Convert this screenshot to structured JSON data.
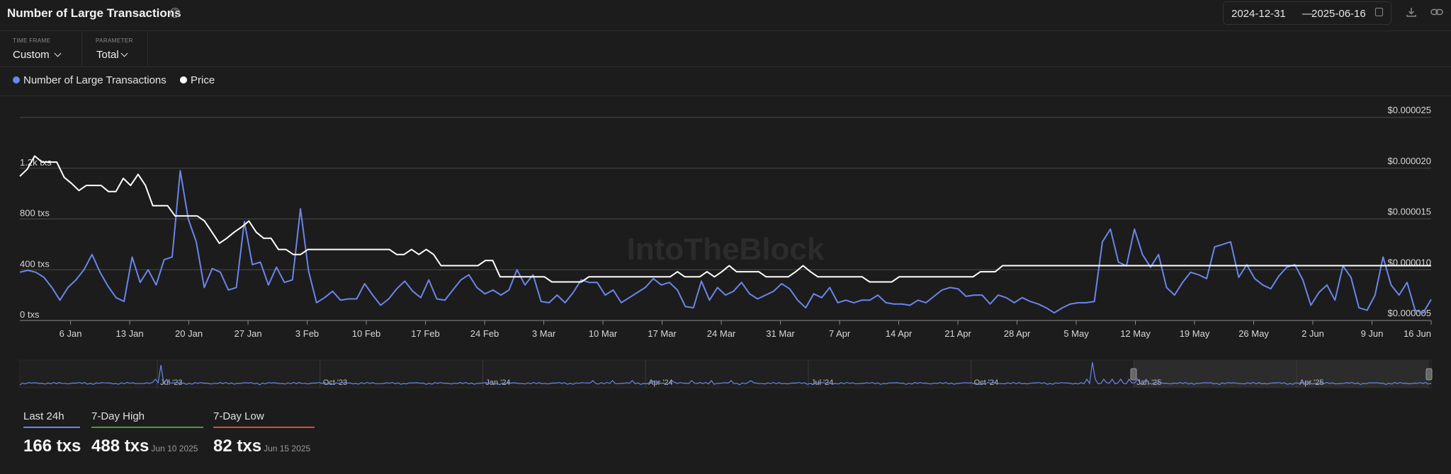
{
  "header": {
    "title": "Number of Large Transactions",
    "help_icon": "?",
    "date_from": "2024-12-31",
    "date_sep": "—",
    "date_to": "2025-06-16"
  },
  "controls": {
    "time_frame_label": "TIME FRAME",
    "time_frame_value": "Custom",
    "parameter_label": "PARAMETER",
    "parameter_value": "Total"
  },
  "legend": {
    "series1": "Number of Large Transactions",
    "series2": "Price"
  },
  "colors": {
    "background": "#1c1c1c",
    "transactions": "#6b85ea",
    "price": "#ffffff",
    "high": "#4f9a3c",
    "low": "#d9502f"
  },
  "watermark": "IntoTheBlock",
  "chart_data": {
    "type": "line",
    "x_start": "2024-12-31",
    "x_end": "2025-06-16",
    "x_tick_labels": [
      "6 Jan",
      "13 Jan",
      "20 Jan",
      "27 Jan",
      "3 Feb",
      "10 Feb",
      "17 Feb",
      "24 Feb",
      "3 Mar",
      "10 Mar",
      "17 Mar",
      "24 Mar",
      "31 Mar",
      "7 Apr",
      "14 Apr",
      "21 Apr",
      "28 Apr",
      "5 May",
      "12 May",
      "19 May",
      "26 May",
      "2 Jun",
      "9 Jun",
      "16 Jun"
    ],
    "y_left": {
      "ticks": [
        "0 txs",
        "400 txs",
        "800 txs",
        "1.2k txs"
      ],
      "range": [
        0,
        1600
      ]
    },
    "y_right": {
      "ticks": [
        "$0.000005",
        "$0.000010",
        "$0.000015",
        "$0.000020",
        "$0.000025"
      ],
      "range": [
        5e-06,
        2.5e-05
      ]
    },
    "series": [
      {
        "name": "Number of Large Transactions",
        "axis": "left",
        "values": [
          380,
          395,
          380,
          340,
          260,
          160,
          260,
          320,
          400,
          520,
          380,
          270,
          180,
          150,
          500,
          300,
          400,
          280,
          480,
          500,
          1180,
          800,
          620,
          260,
          410,
          380,
          240,
          260,
          780,
          440,
          460,
          280,
          420,
          300,
          320,
          880,
          390,
          140,
          180,
          230,
          160,
          170,
          170,
          290,
          200,
          120,
          170,
          250,
          310,
          230,
          180,
          320,
          170,
          160,
          240,
          320,
          360,
          260,
          210,
          240,
          200,
          240,
          400,
          280,
          360,
          150,
          140,
          200,
          140,
          220,
          320,
          300,
          300,
          200,
          240,
          140,
          180,
          220,
          260,
          330,
          280,
          300,
          240,
          110,
          100,
          310,
          160,
          260,
          200,
          230,
          300,
          210,
          170,
          200,
          230,
          290,
          250,
          160,
          100,
          210,
          180,
          260,
          140,
          160,
          140,
          160,
          160,
          200,
          140,
          130,
          130,
          120,
          160,
          140,
          190,
          240,
          260,
          250,
          190,
          200,
          200,
          130,
          200,
          180,
          140,
          180,
          150,
          130,
          100,
          60,
          100,
          130,
          140,
          140,
          150,
          620,
          720,
          460,
          430,
          720,
          520,
          420,
          520,
          260,
          200,
          300,
          380,
          360,
          330,
          580,
          600,
          620,
          340,
          440,
          330,
          280,
          250,
          350,
          420,
          440,
          320,
          120,
          220,
          280,
          160,
          430,
          340,
          100,
          80,
          200,
          500,
          280,
          200,
          300,
          80,
          60,
          166
        ]
      },
      {
        "name": "Price",
        "axis": "right",
        "values": [
          1.92e-05,
          1.99e-05,
          2.12e-05,
          2.06e-05,
          2.06e-05,
          2.06e-05,
          1.91e-05,
          1.85e-05,
          1.78e-05,
          1.83e-05,
          1.83e-05,
          1.83e-05,
          1.77e-05,
          1.77e-05,
          1.9e-05,
          1.83e-05,
          1.94e-05,
          1.83e-05,
          1.63e-05,
          1.63e-05,
          1.63e-05,
          1.53e-05,
          1.53e-05,
          1.53e-05,
          1.53e-05,
          1.48e-05,
          1.37e-05,
          1.26e-05,
          1.31e-05,
          1.37e-05,
          1.42e-05,
          1.48e-05,
          1.37e-05,
          1.31e-05,
          1.31e-05,
          1.2e-05,
          1.2e-05,
          1.15e-05,
          1.15e-05,
          1.2e-05,
          1.2e-05,
          1.2e-05,
          1.2e-05,
          1.2e-05,
          1.2e-05,
          1.2e-05,
          1.2e-05,
          1.2e-05,
          1.2e-05,
          1.2e-05,
          1.2e-05,
          1.15e-05,
          1.15e-05,
          1.2e-05,
          1.15e-05,
          1.2e-05,
          1.15e-05,
          1.04e-05,
          1.04e-05,
          1.04e-05,
          1.04e-05,
          1.04e-05,
          1.04e-05,
          1.09e-05,
          1.09e-05,
          9.3e-06,
          9.3e-06,
          9.3e-06,
          9.3e-06,
          9.3e-06,
          9.3e-06,
          9.3e-06,
          8.8e-06,
          8.8e-06,
          8.8e-06,
          8.8e-06,
          8.8e-06,
          9.3e-06,
          9.3e-06,
          9.3e-06,
          9.3e-06,
          9.3e-06,
          9.3e-06,
          9.3e-06,
          9.3e-06,
          9.3e-06,
          9.3e-06,
          9.3e-06,
          9.3e-06,
          9.8e-06,
          9.3e-06,
          9.3e-06,
          9.3e-06,
          9.8e-06,
          9.3e-06,
          9.8e-06,
          1.04e-05,
          9.8e-06,
          9.8e-06,
          9.8e-06,
          9.8e-06,
          9.3e-06,
          9.3e-06,
          9.3e-06,
          9.3e-06,
          9.8e-06,
          1.04e-05,
          9.8e-06,
          9.3e-06,
          9.3e-06,
          9.3e-06,
          9.3e-06,
          9.3e-06,
          9.3e-06,
          9.3e-06,
          8.8e-06,
          8.8e-06,
          8.8e-06,
          8.8e-06,
          9.3e-06,
          9.3e-06,
          9.3e-06,
          9.3e-06,
          9.3e-06,
          9.3e-06,
          9.3e-06,
          9.3e-06,
          9.3e-06,
          9.3e-06,
          9.3e-06,
          9.8e-06,
          9.8e-06,
          9.8e-06,
          1.04e-05,
          1.04e-05,
          1.04e-05,
          1.04e-05,
          1.04e-05,
          1.04e-05,
          1.04e-05,
          1.04e-05,
          1.04e-05,
          1.04e-05,
          1.04e-05,
          1.04e-05,
          1.04e-05,
          1.04e-05,
          1.04e-05,
          1.04e-05,
          1.04e-05,
          1.04e-05,
          1.04e-05,
          1.04e-05,
          1.04e-05,
          1.04e-05,
          1.04e-05,
          1.04e-05,
          1.04e-05,
          1.04e-05,
          1.04e-05,
          1.04e-05,
          1.04e-05,
          1.04e-05,
          1.04e-05,
          1.04e-05,
          1.04e-05,
          1.04e-05,
          1.04e-05,
          1.04e-05,
          1.04e-05,
          1.04e-05,
          1.04e-05,
          1.04e-05,
          1.04e-05,
          1.04e-05,
          1.04e-05,
          1.04e-05,
          1.04e-05,
          1.04e-05,
          1.04e-05,
          1.04e-05,
          1.04e-05,
          1.04e-05,
          1.04e-05,
          1.04e-05,
          1.04e-05,
          1.04e-05,
          1.04e-05,
          1.04e-05,
          1.04e-05,
          1.04e-05,
          1.04e-05
        ]
      }
    ],
    "grid": true,
    "legend_position": "top-left",
    "navigator": {
      "labels": [
        "Jul '23",
        "Oct '23",
        "Jan '24",
        "Apr '24",
        "Jul '24",
        "Oct '24",
        "Jan '25",
        "Apr '25"
      ],
      "selected_from": "Jan '25",
      "selected_to": "Jun '25"
    }
  },
  "stats": [
    {
      "label": "Last 24h",
      "value": "166 txs",
      "date": ""
    },
    {
      "label": "7-Day High",
      "value": "488 txs",
      "date": "Jun 10 2025"
    },
    {
      "label": "7-Day Low",
      "value": "82 txs",
      "date": "Jun 15 2025"
    }
  ]
}
